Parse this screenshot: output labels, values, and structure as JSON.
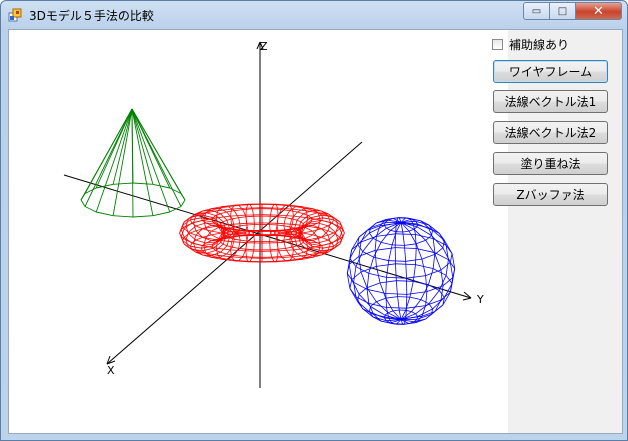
{
  "window": {
    "title": "3Dモデル５手法の比較",
    "controls": {
      "minimize": "▭",
      "maximize": "□",
      "close": "✕"
    }
  },
  "options": {
    "aux_lines_label": "補助線あり",
    "aux_lines_checked": false
  },
  "buttons": [
    {
      "label": "ワイヤフレーム",
      "focused": true
    },
    {
      "label": "法線ベクトル法1",
      "focused": false
    },
    {
      "label": "法線ベクトル法2",
      "focused": false
    },
    {
      "label": "塗り重ね法",
      "focused": false
    },
    {
      "label": "Zバッファ法",
      "focused": false
    }
  ],
  "scene": {
    "axes": {
      "x_label": "X",
      "y_label": "Y",
      "z_label": "Z"
    },
    "objects": [
      {
        "name": "cone",
        "color": "#008000"
      },
      {
        "name": "torus",
        "color": "#ff0000"
      },
      {
        "name": "sphere",
        "color": "#0000ff"
      }
    ],
    "axis_color": "#000000"
  }
}
